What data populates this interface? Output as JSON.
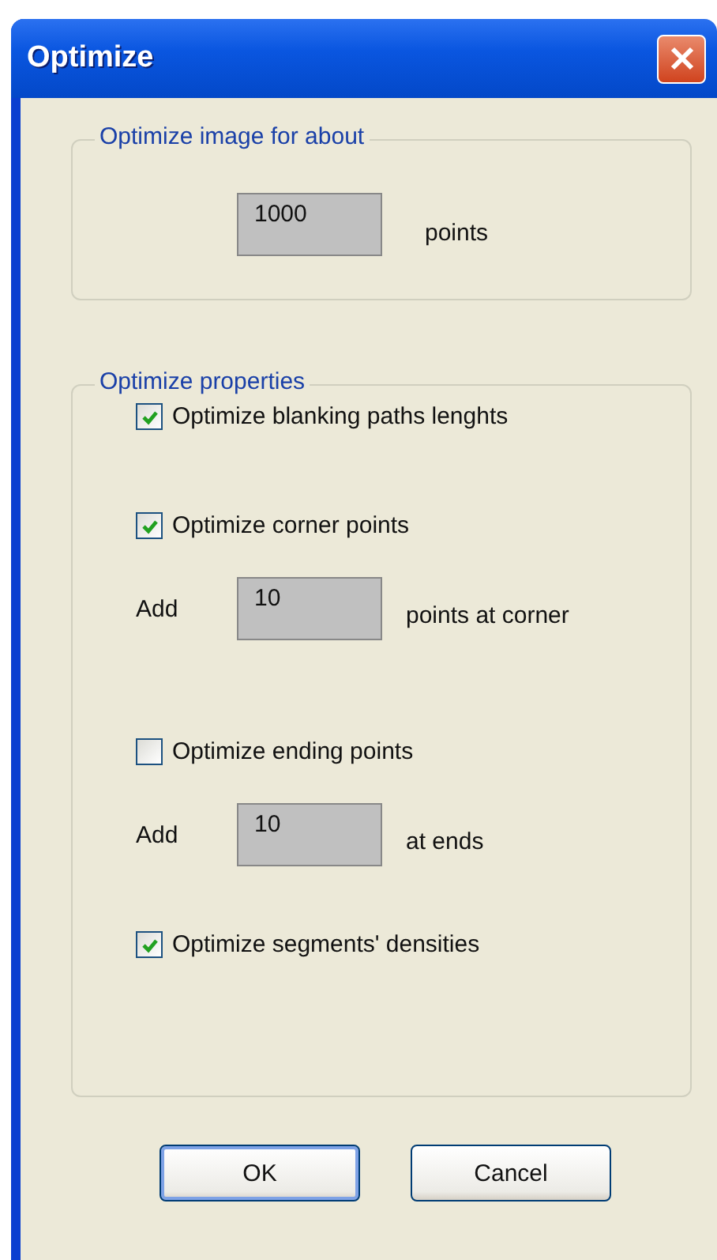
{
  "window": {
    "title": "Optimize"
  },
  "image_group": {
    "legend": "Optimize image for about",
    "value": "1000",
    "unit": "points"
  },
  "properties_group": {
    "legend": "Optimize properties",
    "items": [
      {
        "label": "Optimize blanking paths lenghts",
        "checked": true
      },
      {
        "label": "Optimize corner points",
        "checked": true,
        "amount": {
          "prefix": "Add",
          "value": "10",
          "unit": "points at corner"
        }
      },
      {
        "label": "Optimize ending points",
        "checked": false,
        "amount": {
          "prefix": "Add",
          "value": "10",
          "unit": "at ends"
        }
      },
      {
        "label": "Optimize segments' densities",
        "checked": true
      }
    ]
  },
  "buttons": [
    {
      "label": "OK",
      "default": true
    },
    {
      "label": "Cancel",
      "default": false
    }
  ]
}
